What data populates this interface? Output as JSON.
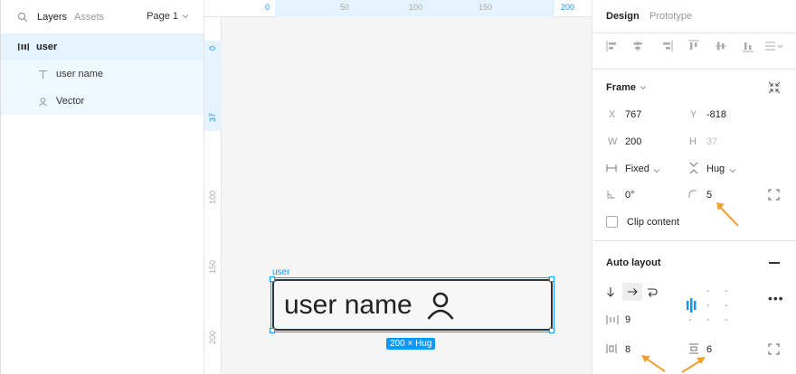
{
  "left_panel": {
    "tabs": [
      "Layers",
      "Assets"
    ],
    "page_selector": "Page 1",
    "layers": [
      {
        "name": "user",
        "type": "frame"
      },
      {
        "name": "user name",
        "type": "text"
      },
      {
        "name": "Vector",
        "type": "vector"
      }
    ]
  },
  "rulers": {
    "top_ticks": [
      "0",
      "50",
      "100",
      "150",
      "200"
    ],
    "left_ticks": [
      "0",
      "37",
      "100",
      "150",
      "200"
    ]
  },
  "canvas": {
    "frame_label": "user",
    "frame_text": "user name",
    "size_badge": "200 × Hug"
  },
  "right_panel": {
    "tabs": [
      "Design",
      "Prototype"
    ],
    "frame_section": {
      "title": "Frame",
      "x_label": "X",
      "x_value": "767",
      "y_label": "Y",
      "y_value": "-818",
      "w_label": "W",
      "w_value": "200",
      "h_label": "H",
      "h_value": "37",
      "width_mode": "Fixed",
      "height_mode": "Hug",
      "rotation": "0°",
      "radius": "5",
      "clip_content": "Clip content"
    },
    "auto_layout": {
      "title": "Auto layout",
      "gap": "9",
      "h_padding": "8",
      "v_padding": "6"
    },
    "colors": {
      "accent": "#0d99ff",
      "annotation_arrow": "#f0a030"
    }
  }
}
